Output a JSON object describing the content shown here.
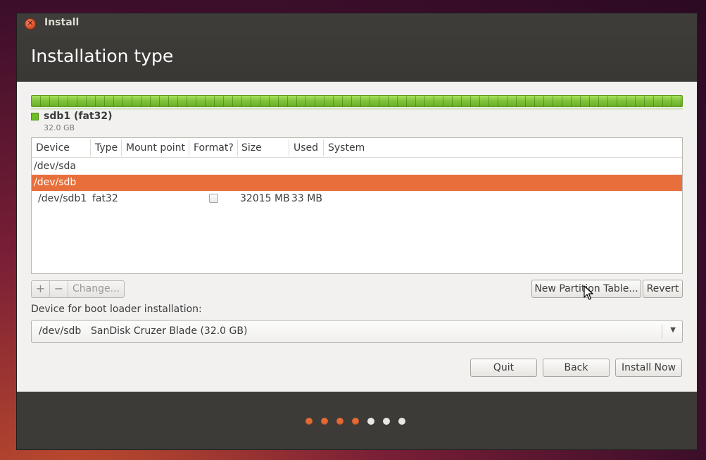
{
  "window": {
    "title": "Install"
  },
  "page": {
    "title": "Installation type"
  },
  "partition_legend": {
    "name": "sdb1 (fat32)",
    "size": "32.0 GB",
    "color": "#6bbf24"
  },
  "table": {
    "columns": [
      "Device",
      "Type",
      "Mount point",
      "Format?",
      "Size",
      "Used",
      "System"
    ],
    "rows": [
      {
        "device": "/dev/sda",
        "type": "",
        "mount": "",
        "format": null,
        "size": "",
        "used": "",
        "system": "",
        "selected": false
      },
      {
        "device": "/dev/sdb",
        "type": "",
        "mount": "",
        "format": null,
        "size": "",
        "used": "",
        "system": "",
        "selected": true
      },
      {
        "device": "/dev/sdb1",
        "type": "fat32",
        "mount": "",
        "format": false,
        "size": "32015 MB",
        "used": "33 MB",
        "system": "",
        "selected": false
      }
    ]
  },
  "toolbar": {
    "add_label": "+",
    "remove_label": "−",
    "change_label": "Change...",
    "new_table_label": "New Partition Table...",
    "revert_label": "Revert"
  },
  "bootloader": {
    "label": "Device for boot loader installation:",
    "device": "/dev/sdb",
    "description": "SanDisk Cruzer Blade (32.0 GB)"
  },
  "actions": {
    "quit_label": "Quit",
    "back_label": "Back",
    "install_label": "Install Now"
  },
  "progress": {
    "total_steps": 7,
    "completed_steps": 4
  },
  "colors": {
    "accent": "#e86f3b",
    "header": "#3c3b37",
    "partition": "#6bbf24"
  }
}
